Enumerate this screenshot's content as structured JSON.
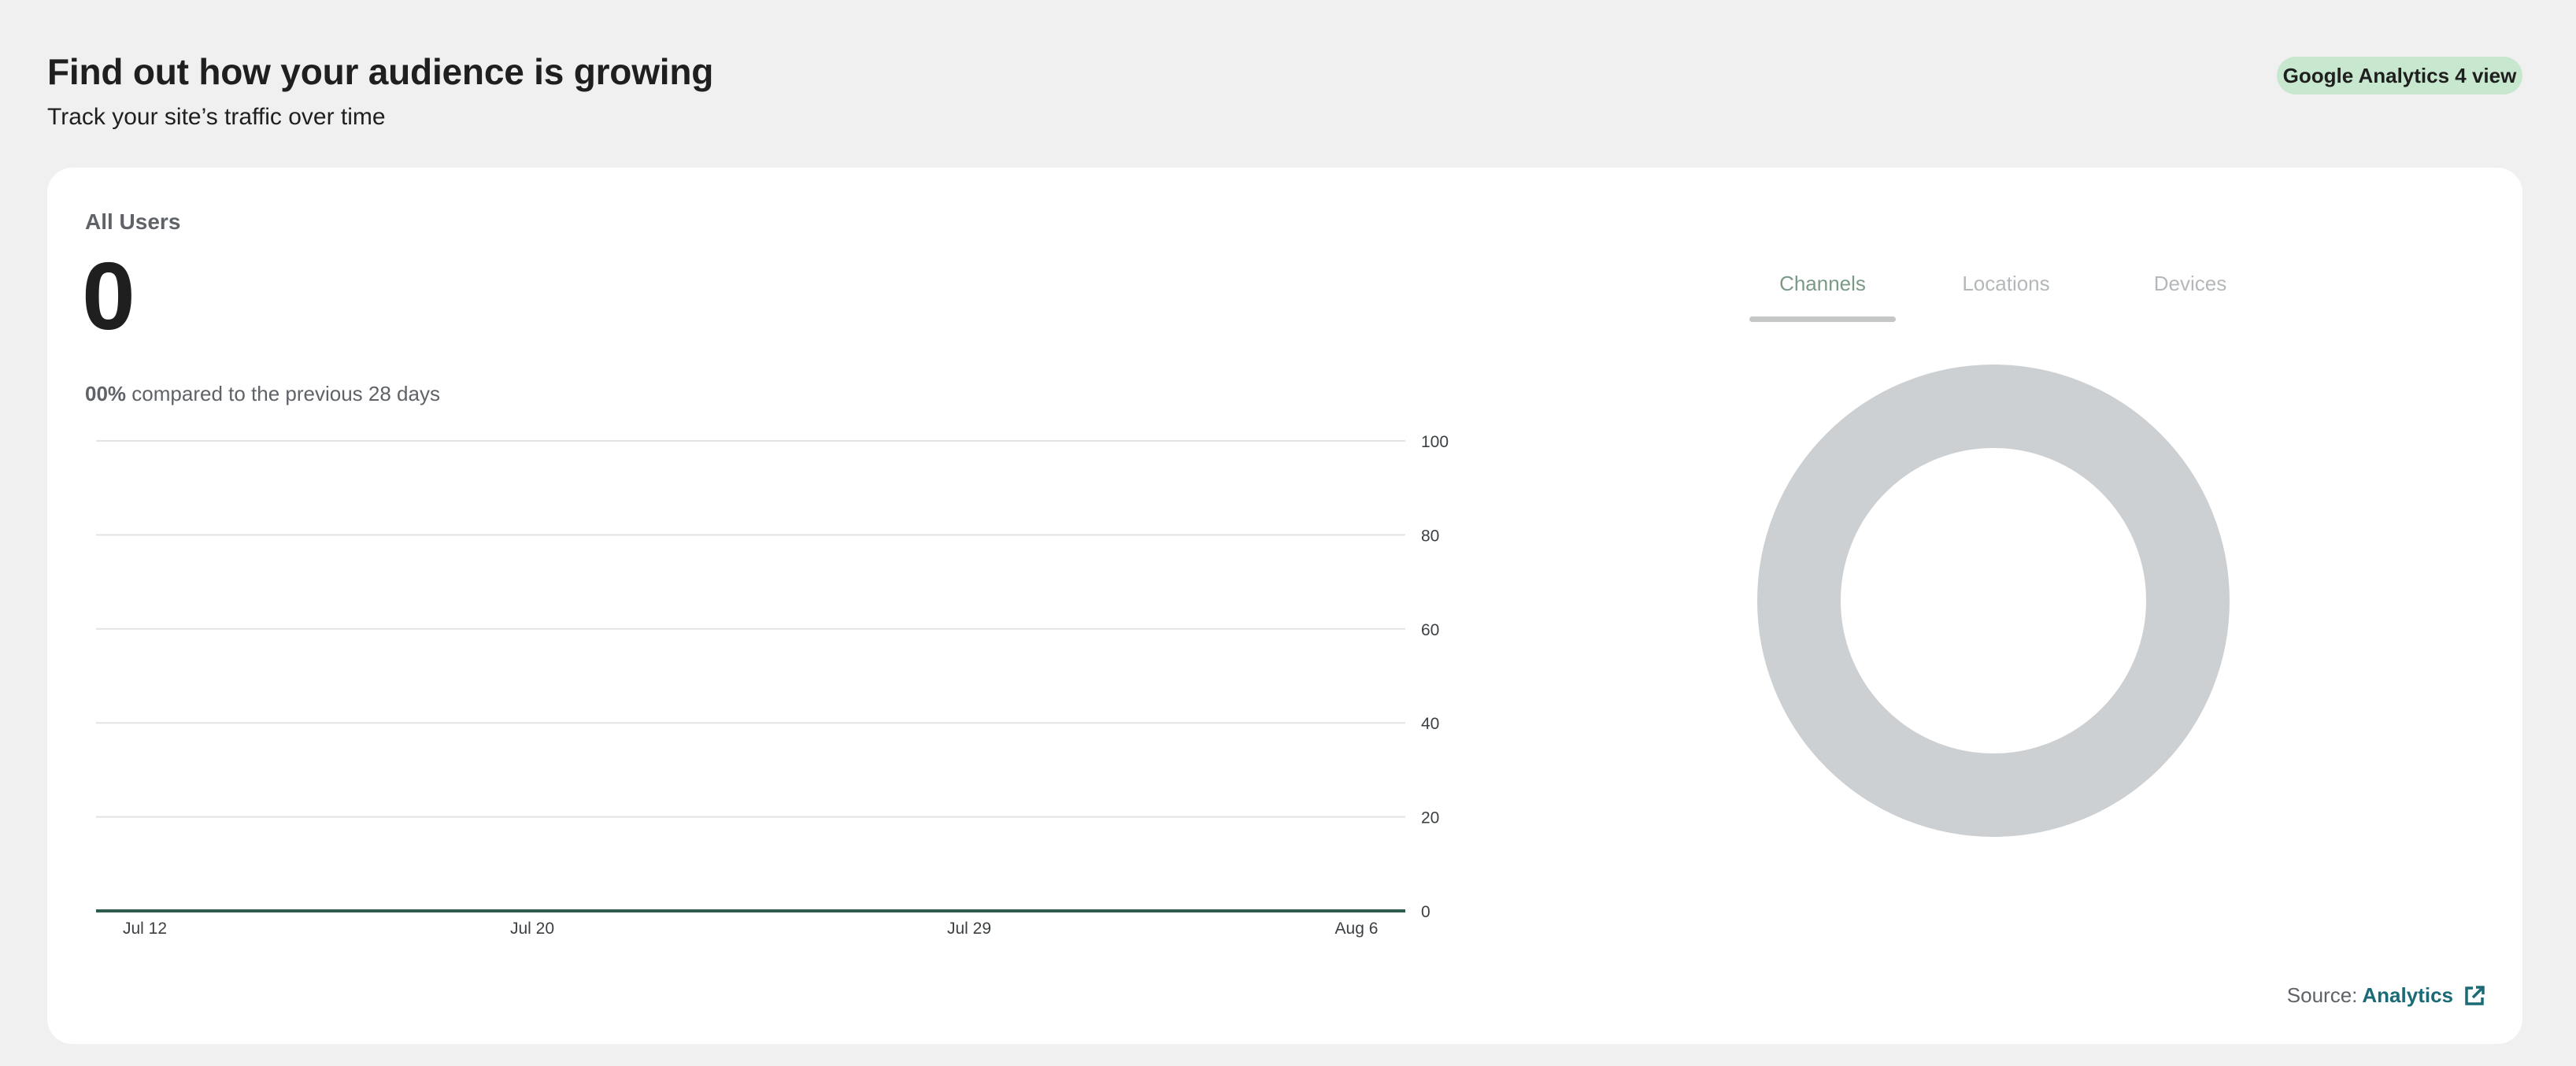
{
  "header": {
    "title": "Find out how your audience is growing",
    "subtitle": "Track your site’s traffic over time",
    "badge": "Google Analytics 4 view"
  },
  "card": {
    "label": "All Users",
    "value": "0",
    "comparison_pct": "00%",
    "comparison_text": "compared to the previous 28 days"
  },
  "tabs": [
    {
      "label": "Channels",
      "active": true
    },
    {
      "label": "Locations",
      "active": false
    },
    {
      "label": "Devices",
      "active": false
    }
  ],
  "source": {
    "prefix": "Source:",
    "link": "Analytics",
    "icon": "external-link-icon"
  },
  "colors": {
    "line": "#2e5d4f",
    "gridline": "#e3e3e3",
    "donut": "#cdd0d2",
    "tab_active": "#7b9a86",
    "tab_inactive": "#b5b8ba",
    "link": "#1a6b75"
  },
  "chart_data": [
    {
      "type": "line",
      "x": [
        "Jul 12",
        "Jul 20",
        "Jul 29",
        "Aug 6"
      ],
      "series": [
        {
          "values": [
            0,
            0,
            0,
            0
          ]
        }
      ],
      "ylim": [
        0,
        100
      ],
      "yticks": [
        0,
        20,
        40,
        60,
        80,
        100
      ],
      "y_axis_side": "right",
      "grid": true
    },
    {
      "type": "pie",
      "variant": "donut",
      "values": [],
      "labels": []
    }
  ]
}
